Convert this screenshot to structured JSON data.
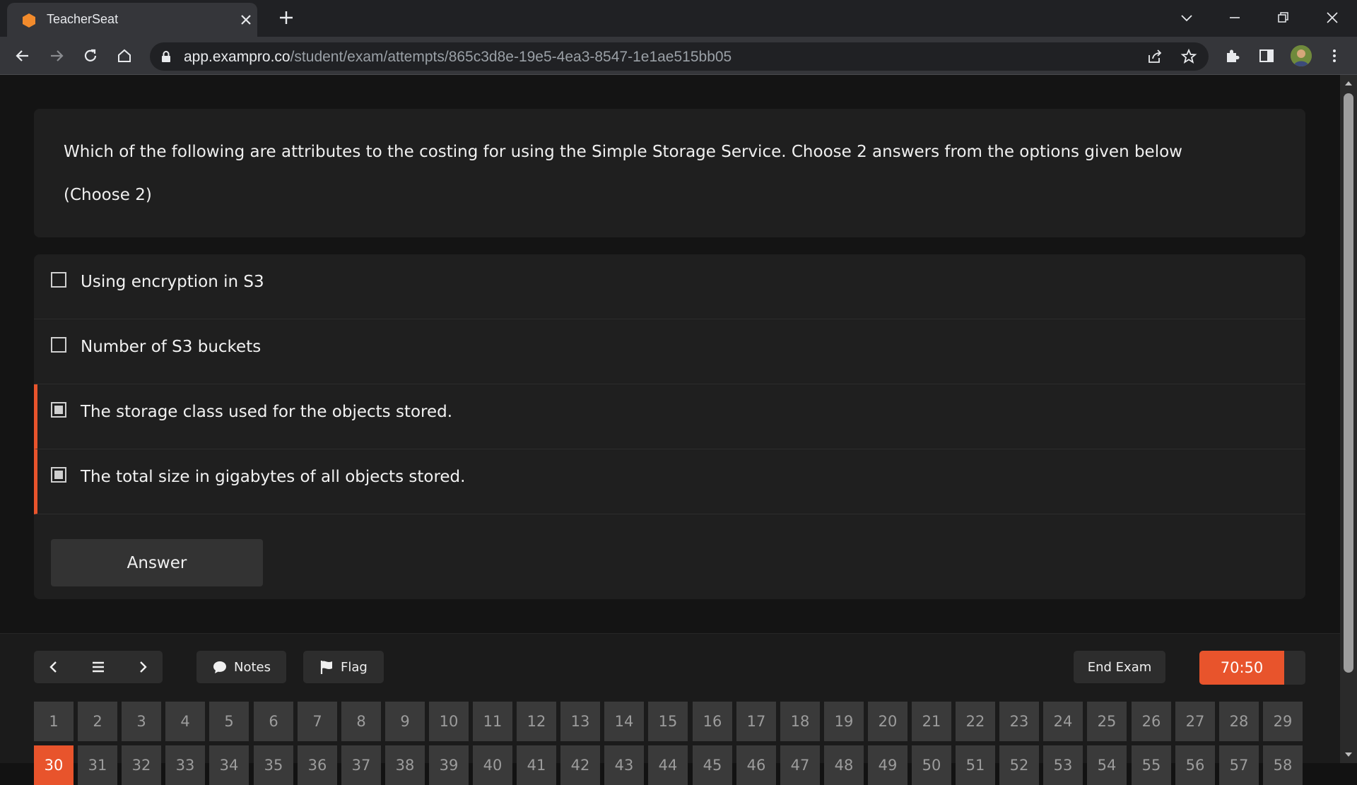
{
  "browser": {
    "tab_title": "TeacherSeat",
    "url_host": "app.exampro.co",
    "url_path": "/student/exam/attempts/865c3d8e-19e5-4ea3-8547-1e1ae515bb05"
  },
  "question": {
    "text": "Which of the following are attributes to the costing for using the Simple Storage Service. Choose 2 answers from the options given below",
    "hint": "(Choose 2)"
  },
  "options": [
    {
      "label": "Using encryption in S3",
      "selected": false
    },
    {
      "label": "Number of S3 buckets",
      "selected": false
    },
    {
      "label": "The storage class used for the objects stored.",
      "selected": true
    },
    {
      "label": "The total size in gigabytes of all objects stored.",
      "selected": true
    }
  ],
  "answer_label": "Answer",
  "footer": {
    "notes_label": "Notes",
    "flag_label": "Flag",
    "end_exam_label": "End Exam",
    "timer": "70:50",
    "timer_remaining_fraction": 0.8
  },
  "question_numbers_row1": [
    "1",
    "2",
    "3",
    "4",
    "5",
    "6",
    "7",
    "8",
    "9",
    "10",
    "11",
    "12",
    "13",
    "14",
    "15",
    "16",
    "17",
    "18",
    "19",
    "20",
    "21",
    "22",
    "23",
    "24",
    "25",
    "26",
    "27",
    "28",
    "29"
  ],
  "question_numbers_row2": [
    "30",
    "31",
    "32",
    "33",
    "34",
    "35",
    "36",
    "37",
    "38",
    "39",
    "40",
    "41",
    "42",
    "43",
    "44",
    "45",
    "46",
    "47",
    "48",
    "49",
    "50",
    "51",
    "52",
    "53",
    "54",
    "55",
    "56",
    "57",
    "58"
  ],
  "current_question": "30",
  "colors": {
    "accent": "#e8542c",
    "background": "#141414",
    "card": "#1f1f1f",
    "favicon": "#f28b2c"
  },
  "icons": {
    "favicon": "hexagon-icon",
    "notes": "speech-bubble-icon",
    "flag": "flag-icon"
  }
}
